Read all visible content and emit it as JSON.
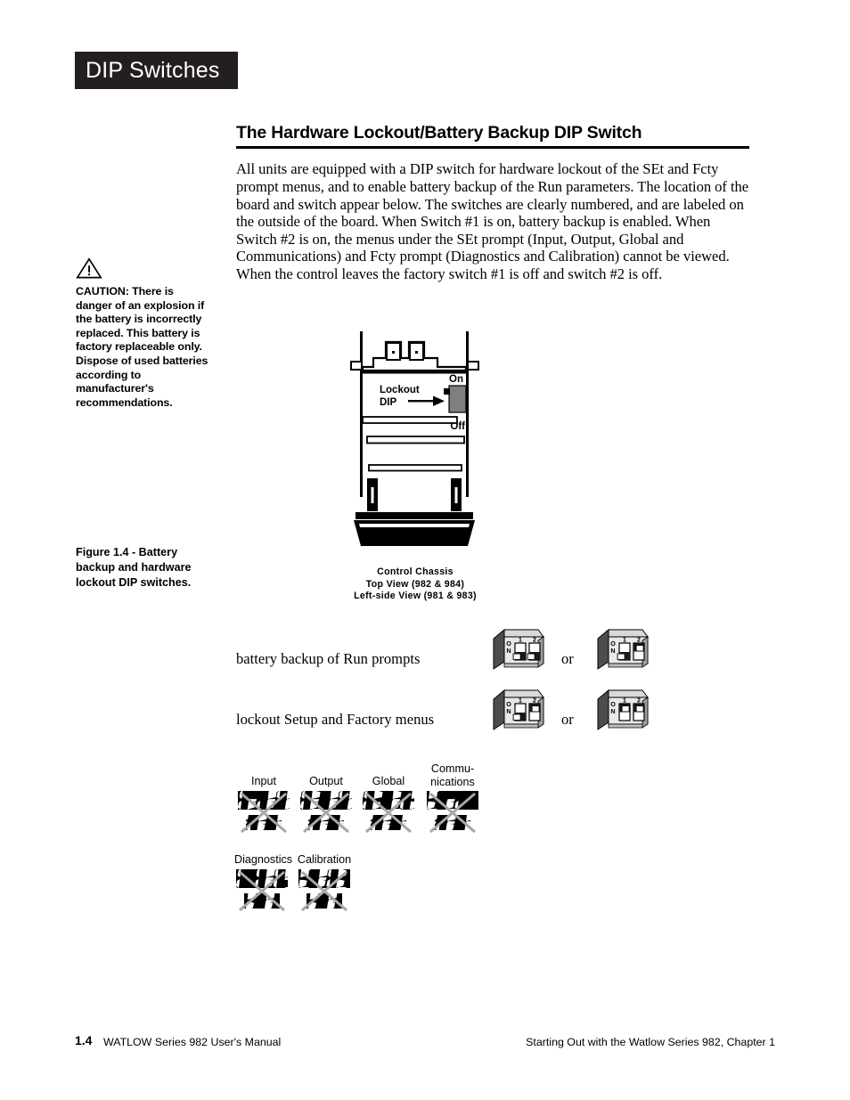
{
  "chapter_tab": {
    "label": "DIP Switches"
  },
  "section": {
    "heading": "The Hardware Lockout/Battery Backup DIP Switch",
    "body": "All units are equipped with a DIP switch for hardware lockout of the SEt and Fcty prompt menus, and to enable battery backup of the Run parameters. The location of the board and switch appear below. The switches are clearly numbered, and are labeled on the outside of the board. When Switch #1 is on, battery backup is enabled.  When Switch #2 is on, the menus under the SEt prompt (Input, Output, Global and Communications) and Fcty prompt (Diagnostics and Calibration) cannot be viewed. When the control leaves the factory switch #1 is off and switch #2 is off."
  },
  "caution": {
    "icon": "warning-triangle-icon",
    "text": "CAUTION: There is danger of an explosion if the battery is incorrectly replaced. This battery is factory replaceable only. Dispose of used batteries according to manufacturer's recommendations."
  },
  "figure_caption": {
    "text": "Figure 1.4 - Battery backup and hardware lockout DIP switches."
  },
  "chassis": {
    "lockout_label_line1": "Lockout",
    "lockout_label_line2": "DIP",
    "on_label": "On",
    "off_label": "Off",
    "caption_line1": "Control  Chassis",
    "caption_line2": "Top  View  (982  &  984)",
    "caption_line3": "Left-side  View  (981  &  983)"
  },
  "dip_options": [
    {
      "label": "battery backup of Run prompts",
      "or_text": "or",
      "pack_a": {
        "on_text": "ON",
        "sw1_number": "1",
        "sw2_number": "2",
        "sw1_position": "off",
        "sw2_position": "off"
      },
      "pack_b": {
        "on_text": "ON",
        "sw1_number": "1",
        "sw2_number": "2",
        "sw1_position": "off",
        "sw2_position": "on"
      }
    },
    {
      "label": "lockout Setup and Factory menus",
      "or_text": "or",
      "pack_a": {
        "on_text": "ON",
        "sw1_number": "1",
        "sw2_number": "2",
        "sw1_position": "off",
        "sw2_position": "on"
      },
      "pack_b": {
        "on_text": "ON",
        "sw1_number": "1",
        "sw2_number": "2",
        "sw1_position": "on",
        "sw2_position": "on"
      }
    }
  ],
  "set_prompts": [
    {
      "title": "Input",
      "title_line2": "",
      "top_display": "InPt",
      "bottom_display": "SEt"
    },
    {
      "title": "Output",
      "title_line2": "",
      "top_display": "OtPt",
      "bottom_display": "SEt"
    },
    {
      "title": "Global",
      "title_line2": "",
      "top_display": "gLbL",
      "bottom_display": "SEt"
    },
    {
      "title": "Commu-",
      "title_line2": "nications",
      "top_display": "CoM",
      "bottom_display": "SEt"
    }
  ],
  "fcty_prompts": [
    {
      "title": "Diagnostics",
      "title_line2": "",
      "top_display": "dIAg",
      "bottom_display": "FCty"
    },
    {
      "title": "Calibration",
      "title_line2": "",
      "top_display": "CAL",
      "bottom_display": "FCty"
    }
  ],
  "footer": {
    "page_number": "1.4",
    "manual": "WATLOW Series 982 User's Manual",
    "chapter": "Starting Out with the Watlow Series 982, Chapter 1"
  },
  "colors": {
    "tab_background": "#231f20",
    "tab_text": "#ffffff",
    "ink": "#000000",
    "dip_gray": "#7f7f7f",
    "dip_body_light": "#d9d9d9",
    "strike_gray": "#a6a6a6"
  }
}
